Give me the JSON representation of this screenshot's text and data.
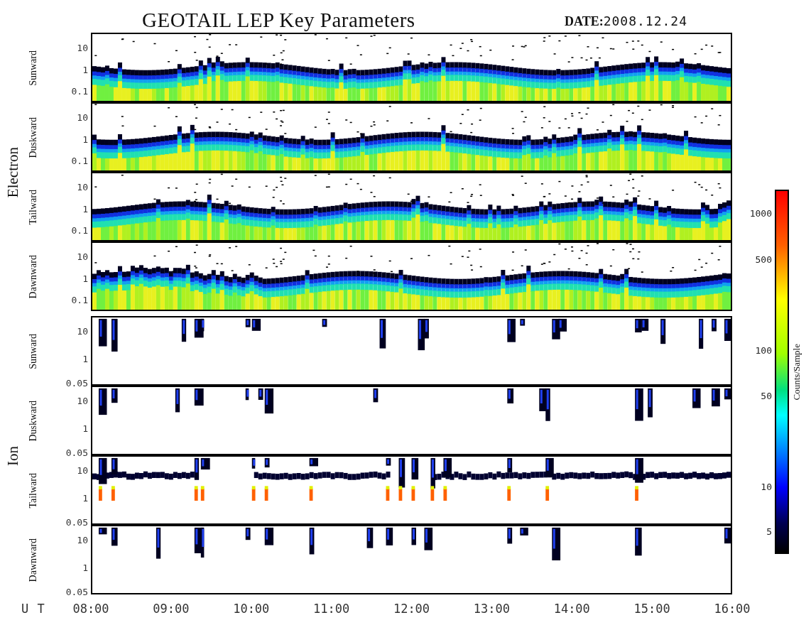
{
  "title": "GEOTAIL LEP Key Parameters",
  "date": {
    "label": "DATE:",
    "value": "2008.12.24"
  },
  "groups": [
    {
      "name": "Electron",
      "kind": "electron",
      "panels": [
        {
          "direction": "Sunward",
          "yticks": [
            "10",
            "1",
            "0.1"
          ]
        },
        {
          "direction": "Duskward",
          "yticks": [
            "10",
            "1",
            "0.1"
          ]
        },
        {
          "direction": "Tailward",
          "yticks": [
            "10",
            "1",
            "0.1"
          ]
        },
        {
          "direction": "Dawnward",
          "yticks": [
            "10",
            "1",
            "0.1"
          ]
        }
      ]
    },
    {
      "name": "Ion",
      "kind": "ion",
      "panels": [
        {
          "direction": "Sunward",
          "yticks": [
            "10",
            "1",
            "0.05"
          ]
        },
        {
          "direction": "Duskward",
          "yticks": [
            "10",
            "1",
            "0.05"
          ]
        },
        {
          "direction": "Tailward",
          "yticks": [
            "10",
            "1",
            "0.05"
          ]
        },
        {
          "direction": "Dawnward",
          "yticks": [
            "10",
            "1",
            "0.05"
          ]
        }
      ]
    }
  ],
  "colorbar": {
    "label": "Counts/Sample",
    "ticks": [
      "1000",
      "500",
      "100",
      "50",
      "10",
      "5"
    ]
  },
  "x_axis": {
    "label": "U T",
    "ticks": [
      "08:00",
      "09:00",
      "10:00",
      "11:00",
      "12:00",
      "13:00",
      "14:00",
      "15:00",
      "16:00"
    ]
  }
}
